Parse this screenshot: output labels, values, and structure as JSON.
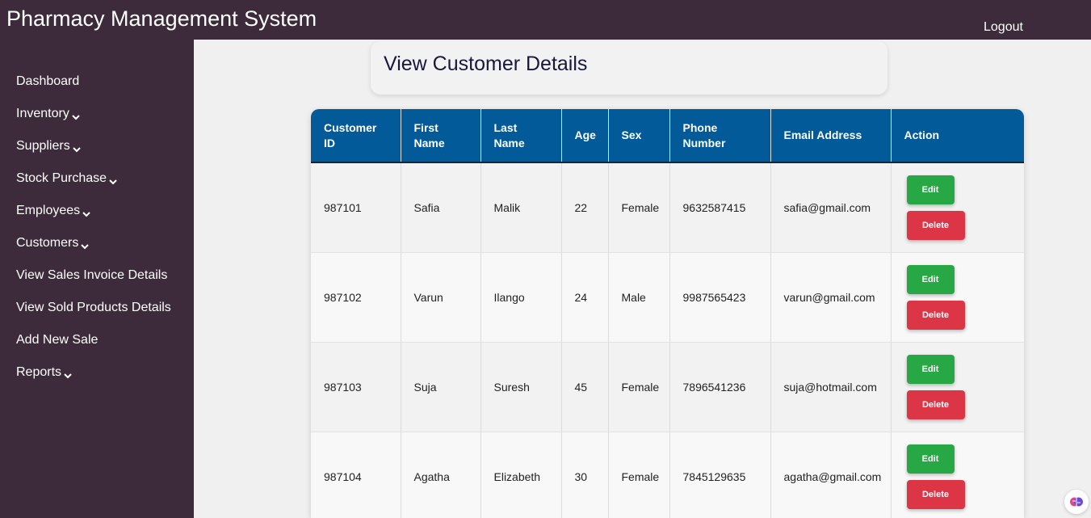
{
  "header": {
    "title": "Pharmacy Management System",
    "logout": "Logout"
  },
  "sidebar": {
    "items": [
      {
        "label": "Dashboard",
        "dropdown": false
      },
      {
        "label": "Inventory",
        "dropdown": true
      },
      {
        "label": "Suppliers",
        "dropdown": true
      },
      {
        "label": "Stock Purchase",
        "dropdown": true
      },
      {
        "label": "Employees",
        "dropdown": true
      },
      {
        "label": "Customers",
        "dropdown": true
      },
      {
        "label": "View Sales Invoice Details",
        "dropdown": false
      },
      {
        "label": "View Sold Products Details",
        "dropdown": false
      },
      {
        "label": "Add New Sale",
        "dropdown": false
      },
      {
        "label": "Reports",
        "dropdown": true
      }
    ]
  },
  "main": {
    "title": "View Customer Details",
    "table": {
      "headers": [
        "Customer ID",
        "First Name",
        "Last Name",
        "Age",
        "Sex",
        "Phone Number",
        "Email Address",
        "Action"
      ],
      "rows": [
        {
          "id": "987101",
          "first": "Safia",
          "last": "Malik",
          "age": "22",
          "sex": "Female",
          "phone": "9632587415",
          "email": "safia@gmail.com"
        },
        {
          "id": "987102",
          "first": "Varun",
          "last": "Ilango",
          "age": "24",
          "sex": "Male",
          "phone": "9987565423",
          "email": "varun@gmail.com"
        },
        {
          "id": "987103",
          "first": "Suja",
          "last": "Suresh",
          "age": "45",
          "sex": "Female",
          "phone": "7896541236",
          "email": "suja@hotmail.com"
        },
        {
          "id": "987104",
          "first": "Agatha",
          "last": "Elizabeth",
          "age": "30",
          "sex": "Female",
          "phone": "7845129635",
          "email": "agatha@gmail.com"
        }
      ],
      "edit_label": "Edit",
      "delete_label": "Delete"
    }
  },
  "colors": {
    "sidebar": "#3d2a3a",
    "table_header": "#035a99",
    "edit": "#28a745",
    "delete": "#dc3545"
  },
  "icons": {
    "dropdown": "chevron-down-icon",
    "assistant": "brain-icon"
  }
}
